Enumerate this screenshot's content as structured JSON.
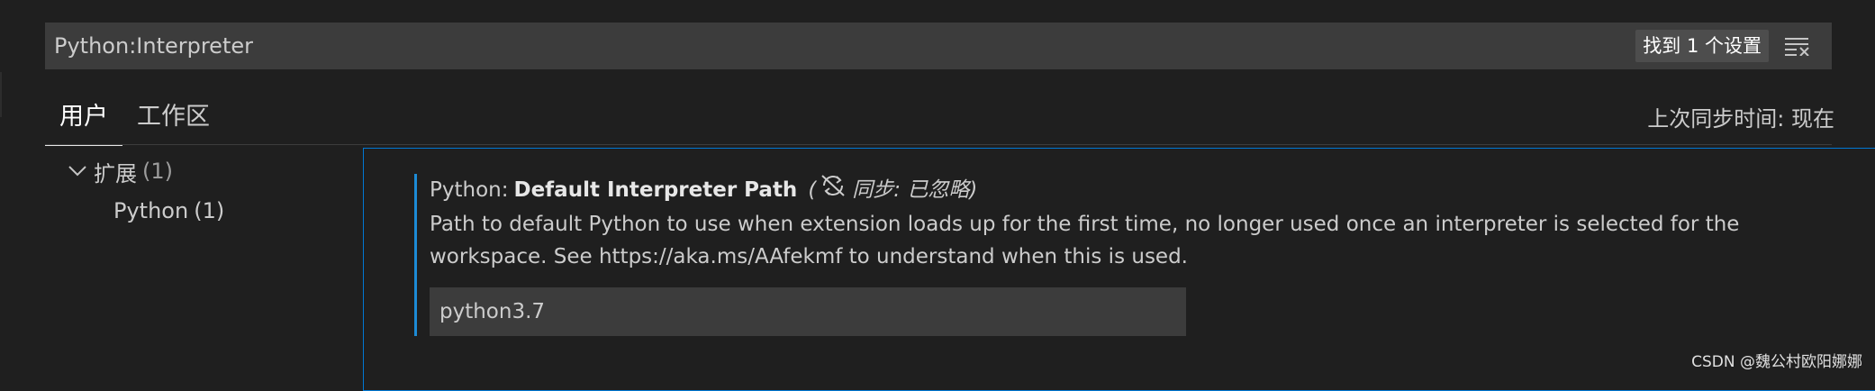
{
  "search": {
    "value": "Python:Interpreter",
    "result_count": "找到 1 个设置"
  },
  "tabs": [
    {
      "label": "用户",
      "active": true
    },
    {
      "label": "工作区",
      "active": false
    }
  ],
  "sync_time": "上次同步时间: 现在",
  "tree": {
    "group": {
      "label": "扩展",
      "count": "(1)"
    },
    "child": {
      "label": "Python",
      "count": "(1)"
    }
  },
  "setting": {
    "category": "Python:",
    "name": "Default Interpreter Path",
    "sync_open": "(",
    "sync_label": "同步: 已忽略)",
    "description_line1": "Path to default Python to use when extension loads up for the first time, no longer used once an interpreter is selected for the",
    "description_line2": "workspace. See https://aka.ms/AAfekmf to understand when this is used.",
    "value": "python3.7"
  },
  "watermark": "CSDN @魏公村欧阳娜娜",
  "colors": {
    "background": "#1f1f1f",
    "input_background": "#3c3c3c",
    "focus_border": "#0078d4",
    "modified_indicator": "#1d8bd6"
  },
  "icons": [
    "clear-filter-icon",
    "chevron-down-icon",
    "sync-ignored-icon"
  ]
}
